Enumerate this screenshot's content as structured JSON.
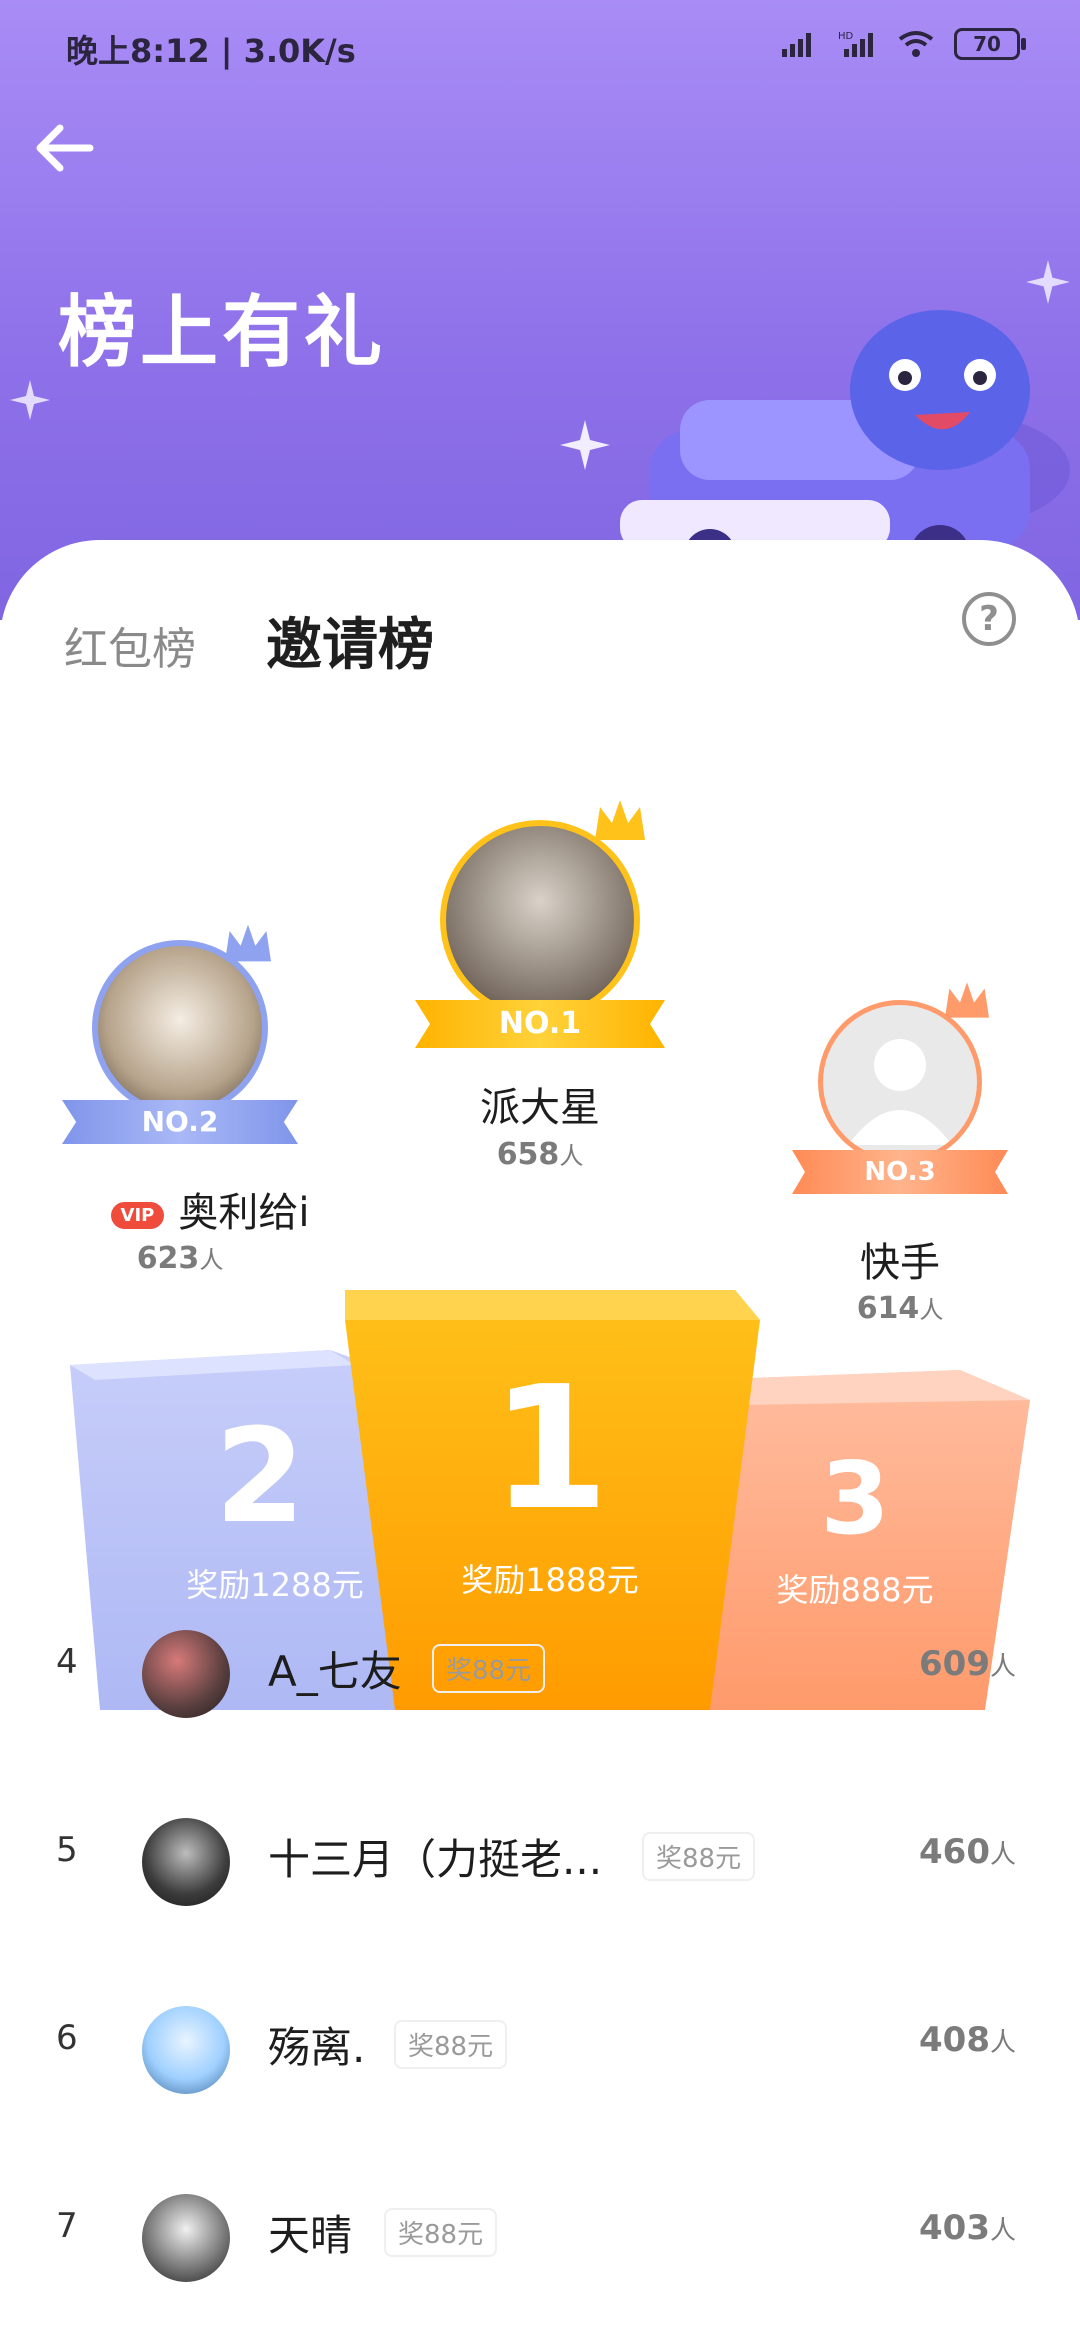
{
  "status_bar": {
    "time_and_speed": "晚上8:12 | 3.0K/s",
    "battery": "70"
  },
  "header": {
    "title": "榜上有礼"
  },
  "tabs": [
    {
      "label": "红包榜",
      "active": false
    },
    {
      "label": "邀请榜",
      "active": true
    }
  ],
  "help": {
    "label": "?"
  },
  "podium": [
    {
      "rank_label": "NO.1",
      "name": "派大星",
      "count": "658",
      "unit": "人",
      "block_number": "1",
      "reward": "奖励1888元"
    },
    {
      "rank_label": "NO.2",
      "name": "奥利给i",
      "vip": "VIP",
      "count": "623",
      "unit": "人",
      "block_number": "2",
      "reward": "奖励1288元"
    },
    {
      "rank_label": "NO.3",
      "name": "快手",
      "count": "614",
      "unit": "人",
      "block_number": "3",
      "reward": "奖励888元"
    }
  ],
  "list": [
    {
      "rank": "4",
      "name": "A_七友",
      "badge": "奖88元",
      "count": "609",
      "unit": "人"
    },
    {
      "rank": "5",
      "name": "十三月（力挺老...",
      "badge": "奖88元",
      "count": "460",
      "unit": "人"
    },
    {
      "rank": "6",
      "name": "殇离.",
      "badge": "奖88元",
      "count": "408",
      "unit": "人"
    },
    {
      "rank": "7",
      "name": "天晴",
      "badge": "奖88元",
      "count": "403",
      "unit": "人"
    }
  ],
  "colors": {
    "header_bg": "#8f72ea",
    "gold": "#f7b500",
    "silver_blue": "#9aa7ef",
    "bronze": "#ff9a6b"
  },
  "icons": {
    "back": "arrow-left-icon",
    "help": "question-circle-icon",
    "crown": "crown-icon"
  }
}
